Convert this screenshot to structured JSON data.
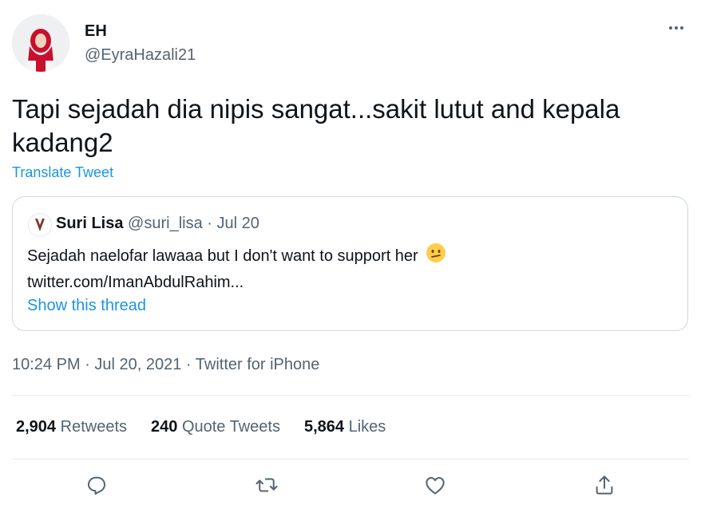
{
  "author": {
    "name": "EH",
    "handle": "@EyraHazali21"
  },
  "tweet": {
    "text": "Tapi sejadah dia nipis sangat...sakit lutut and kepala kadang2",
    "translate_label": "Translate Tweet"
  },
  "quoted_tweet": {
    "name": "Suri Lisa",
    "meta": "@suri_lisa · Jul 20",
    "text": "Sejadah naelofar lawaaa but I don't want to support her",
    "emoji": "confused-face-emoji",
    "link_text": "twitter.com/ImanAbdulRahim...",
    "thread_label": "Show this thread"
  },
  "timestamp": "10:24 PM · Jul 20, 2021 · Twitter for iPhone",
  "stats": {
    "retweets": {
      "count": "2,904",
      "label": "Retweets"
    },
    "quote_tweets": {
      "count": "240",
      "label": "Quote Tweets"
    },
    "likes": {
      "count": "5,864",
      "label": "Likes"
    }
  },
  "icons": {
    "more": "more-horizontal-icon",
    "reply": "reply-icon",
    "retweet": "retweet-icon",
    "like": "heart-icon",
    "share": "share-icon"
  },
  "colors": {
    "link": "#1b95e0",
    "secondary_text": "#536471",
    "primary_text": "#0f1419",
    "border": "#cfd9de",
    "icon": "#536471"
  }
}
